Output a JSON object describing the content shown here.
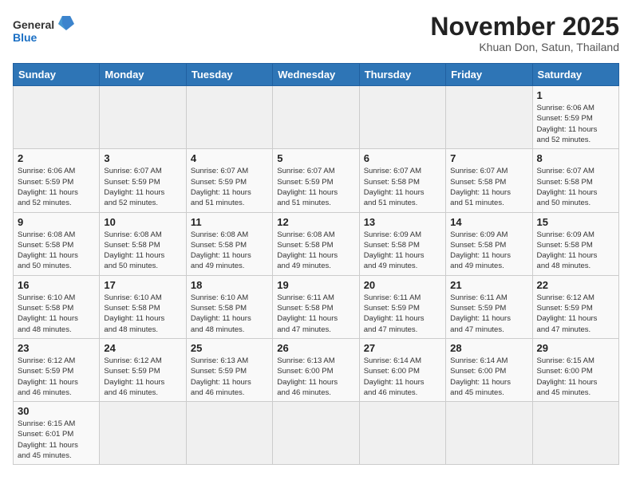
{
  "header": {
    "logo_general": "General",
    "logo_blue": "Blue",
    "month_title": "November 2025",
    "location": "Khuan Don, Satun, Thailand"
  },
  "weekdays": [
    "Sunday",
    "Monday",
    "Tuesday",
    "Wednesday",
    "Thursday",
    "Friday",
    "Saturday"
  ],
  "weeks": [
    [
      {
        "day": "",
        "info": ""
      },
      {
        "day": "",
        "info": ""
      },
      {
        "day": "",
        "info": ""
      },
      {
        "day": "",
        "info": ""
      },
      {
        "day": "",
        "info": ""
      },
      {
        "day": "",
        "info": ""
      },
      {
        "day": "1",
        "info": "Sunrise: 6:06 AM\nSunset: 5:59 PM\nDaylight: 11 hours\nand 52 minutes."
      }
    ],
    [
      {
        "day": "2",
        "info": "Sunrise: 6:06 AM\nSunset: 5:59 PM\nDaylight: 11 hours\nand 52 minutes."
      },
      {
        "day": "3",
        "info": "Sunrise: 6:07 AM\nSunset: 5:59 PM\nDaylight: 11 hours\nand 52 minutes."
      },
      {
        "day": "4",
        "info": "Sunrise: 6:07 AM\nSunset: 5:59 PM\nDaylight: 11 hours\nand 51 minutes."
      },
      {
        "day": "5",
        "info": "Sunrise: 6:07 AM\nSunset: 5:59 PM\nDaylight: 11 hours\nand 51 minutes."
      },
      {
        "day": "6",
        "info": "Sunrise: 6:07 AM\nSunset: 5:58 PM\nDaylight: 11 hours\nand 51 minutes."
      },
      {
        "day": "7",
        "info": "Sunrise: 6:07 AM\nSunset: 5:58 PM\nDaylight: 11 hours\nand 51 minutes."
      },
      {
        "day": "8",
        "info": "Sunrise: 6:07 AM\nSunset: 5:58 PM\nDaylight: 11 hours\nand 50 minutes."
      }
    ],
    [
      {
        "day": "9",
        "info": "Sunrise: 6:08 AM\nSunset: 5:58 PM\nDaylight: 11 hours\nand 50 minutes."
      },
      {
        "day": "10",
        "info": "Sunrise: 6:08 AM\nSunset: 5:58 PM\nDaylight: 11 hours\nand 50 minutes."
      },
      {
        "day": "11",
        "info": "Sunrise: 6:08 AM\nSunset: 5:58 PM\nDaylight: 11 hours\nand 49 minutes."
      },
      {
        "day": "12",
        "info": "Sunrise: 6:08 AM\nSunset: 5:58 PM\nDaylight: 11 hours\nand 49 minutes."
      },
      {
        "day": "13",
        "info": "Sunrise: 6:09 AM\nSunset: 5:58 PM\nDaylight: 11 hours\nand 49 minutes."
      },
      {
        "day": "14",
        "info": "Sunrise: 6:09 AM\nSunset: 5:58 PM\nDaylight: 11 hours\nand 49 minutes."
      },
      {
        "day": "15",
        "info": "Sunrise: 6:09 AM\nSunset: 5:58 PM\nDaylight: 11 hours\nand 48 minutes."
      }
    ],
    [
      {
        "day": "16",
        "info": "Sunrise: 6:10 AM\nSunset: 5:58 PM\nDaylight: 11 hours\nand 48 minutes."
      },
      {
        "day": "17",
        "info": "Sunrise: 6:10 AM\nSunset: 5:58 PM\nDaylight: 11 hours\nand 48 minutes."
      },
      {
        "day": "18",
        "info": "Sunrise: 6:10 AM\nSunset: 5:58 PM\nDaylight: 11 hours\nand 48 minutes."
      },
      {
        "day": "19",
        "info": "Sunrise: 6:11 AM\nSunset: 5:58 PM\nDaylight: 11 hours\nand 47 minutes."
      },
      {
        "day": "20",
        "info": "Sunrise: 6:11 AM\nSunset: 5:59 PM\nDaylight: 11 hours\nand 47 minutes."
      },
      {
        "day": "21",
        "info": "Sunrise: 6:11 AM\nSunset: 5:59 PM\nDaylight: 11 hours\nand 47 minutes."
      },
      {
        "day": "22",
        "info": "Sunrise: 6:12 AM\nSunset: 5:59 PM\nDaylight: 11 hours\nand 47 minutes."
      }
    ],
    [
      {
        "day": "23",
        "info": "Sunrise: 6:12 AM\nSunset: 5:59 PM\nDaylight: 11 hours\nand 46 minutes."
      },
      {
        "day": "24",
        "info": "Sunrise: 6:12 AM\nSunset: 5:59 PM\nDaylight: 11 hours\nand 46 minutes."
      },
      {
        "day": "25",
        "info": "Sunrise: 6:13 AM\nSunset: 5:59 PM\nDaylight: 11 hours\nand 46 minutes."
      },
      {
        "day": "26",
        "info": "Sunrise: 6:13 AM\nSunset: 6:00 PM\nDaylight: 11 hours\nand 46 minutes."
      },
      {
        "day": "27",
        "info": "Sunrise: 6:14 AM\nSunset: 6:00 PM\nDaylight: 11 hours\nand 46 minutes."
      },
      {
        "day": "28",
        "info": "Sunrise: 6:14 AM\nSunset: 6:00 PM\nDaylight: 11 hours\nand 45 minutes."
      },
      {
        "day": "29",
        "info": "Sunrise: 6:15 AM\nSunset: 6:00 PM\nDaylight: 11 hours\nand 45 minutes."
      }
    ],
    [
      {
        "day": "30",
        "info": "Sunrise: 6:15 AM\nSunset: 6:01 PM\nDaylight: 11 hours\nand 45 minutes."
      },
      {
        "day": "",
        "info": ""
      },
      {
        "day": "",
        "info": ""
      },
      {
        "day": "",
        "info": ""
      },
      {
        "day": "",
        "info": ""
      },
      {
        "day": "",
        "info": ""
      },
      {
        "day": "",
        "info": ""
      }
    ]
  ]
}
